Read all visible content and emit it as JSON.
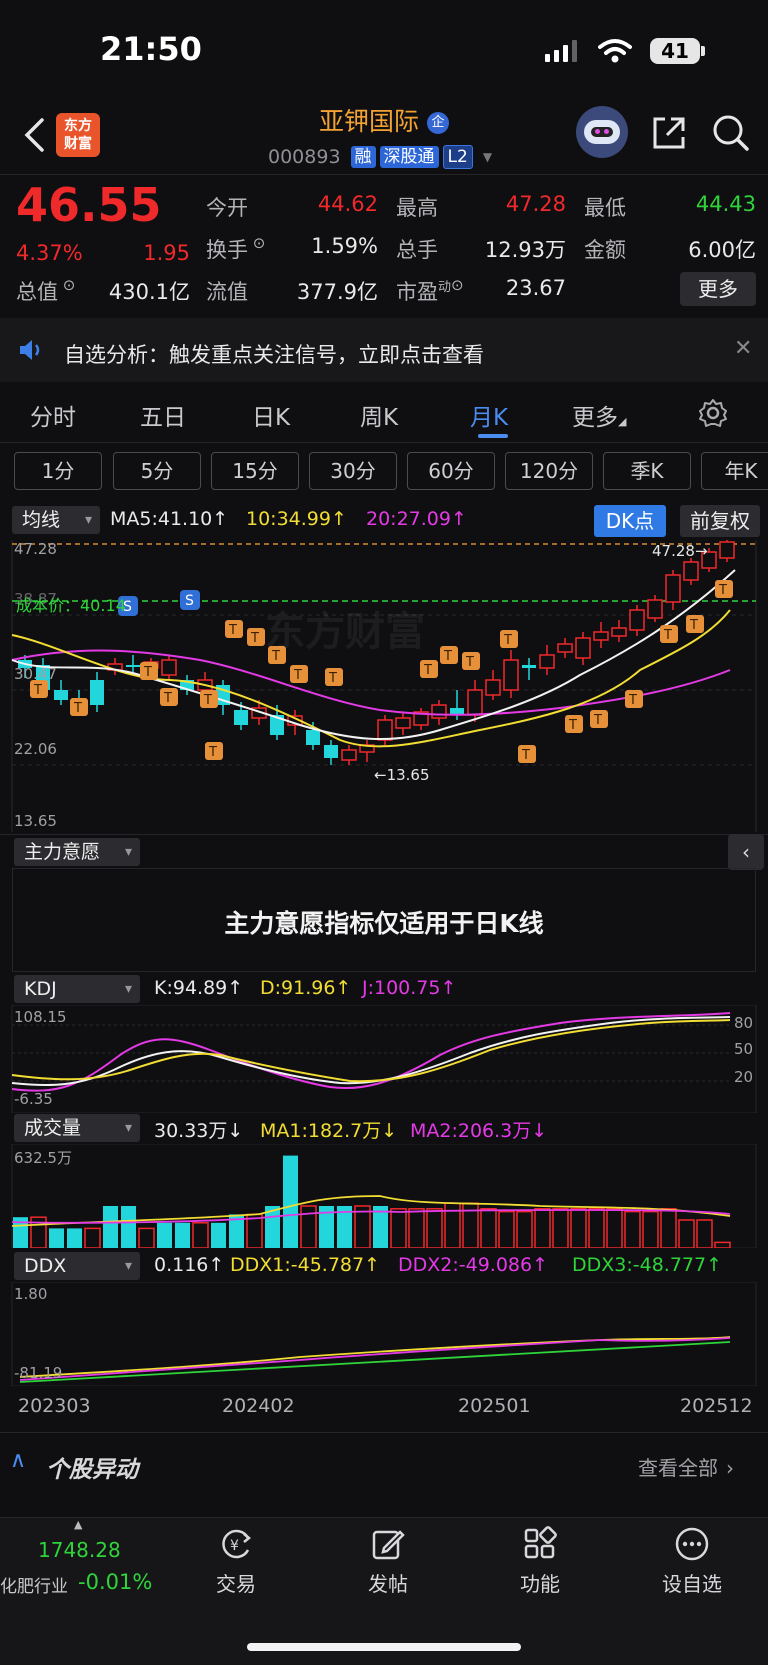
{
  "status_bar": {
    "time": "21:50",
    "battery": "41"
  },
  "header": {
    "stock_name": "亚钾国际",
    "badge": "企",
    "code": "000893",
    "tags": [
      "融",
      "深股通",
      "L2"
    ],
    "logo_text": "东方\n财富"
  },
  "quote": {
    "price": "46.55",
    "change_pct": "4.37%",
    "change": "1.95",
    "rows": [
      [
        {
          "label": "今开",
          "value": "44.62",
          "color": "red"
        },
        {
          "label": "最高",
          "value": "47.28",
          "color": "red"
        },
        {
          "label": "最低",
          "value": "44.43",
          "color": "green"
        }
      ],
      [
        {
          "label": "换手",
          "value": "1.59%",
          "color": "white"
        },
        {
          "label": "总手",
          "value": "12.93万",
          "color": "white"
        },
        {
          "label": "金额",
          "value": "6.00亿",
          "color": "white"
        }
      ],
      [
        {
          "label": "总值",
          "value": "430.1亿",
          "color": "white"
        },
        {
          "label": "流值",
          "value": "377.9亿",
          "color": "white"
        },
        {
          "label": "市盈",
          "value": "23.67",
          "color": "white"
        }
      ]
    ],
    "more_label": "更多"
  },
  "banner": {
    "text": "自选分析：触发重点关注信号，立即点击查看"
  },
  "tabs": [
    "分时",
    "五日",
    "日K",
    "周K",
    "月K",
    "更多"
  ],
  "active_tab": "月K",
  "periods": [
    "1分",
    "5分",
    "15分",
    "30分",
    "60分",
    "120分",
    "季K",
    "年K"
  ],
  "main_chart": {
    "selector": "均线",
    "ma5": "MA5:41.10↑",
    "ma10": "10:34.99↑",
    "ma20": "20:27.09↑",
    "dk_label": "DK点",
    "fq_label": "前复权",
    "y_labels": [
      "47.28",
      "38.87",
      "30.47",
      "22.06",
      "13.65"
    ],
    "cost_label": "成本价：40.14",
    "high_marker": "47.28→",
    "low_marker": "←13.65",
    "watermark": "东方财富"
  },
  "zhuli": {
    "selector": "主力意愿",
    "message": "主力意愿指标仅适用于日K线"
  },
  "kdj": {
    "selector": "KDJ",
    "k": "K:94.89↑",
    "d": "D:91.96↑",
    "j": "J:100.75↑",
    "y_top": "108.15",
    "y_bottom": "-6.35",
    "levels": [
      "80",
      "50",
      "20"
    ]
  },
  "volume": {
    "selector": "成交量",
    "vol": "30.33万↓",
    "ma1": "MA1:182.7万↓",
    "ma2": "MA2:206.3万↓",
    "y_top": "632.5万"
  },
  "ddx": {
    "selector": "DDX",
    "v": "0.116↑",
    "ddx1": "DDX1:-45.787↑",
    "ddx2": "DDX2:-49.086↑",
    "ddx3": "DDX3:-48.777↑",
    "y_top": "1.80",
    "y_bottom": "-81.19"
  },
  "x_axis": [
    "202303",
    "202402",
    "202501",
    "202512"
  ],
  "movement": {
    "title": "个股异动",
    "link": "查看全部"
  },
  "bottom_nav": {
    "index_value": "1748.28",
    "index_name": "化肥行业",
    "index_change": "-0.01%",
    "items": [
      "交易",
      "发帖",
      "功能",
      "设自选"
    ]
  },
  "colors": {
    "up": "#f0292b",
    "down": "#2fd43a",
    "cyan": "#22d6dc",
    "accent": "#4a8cf0",
    "orange": "#f4a233"
  }
}
